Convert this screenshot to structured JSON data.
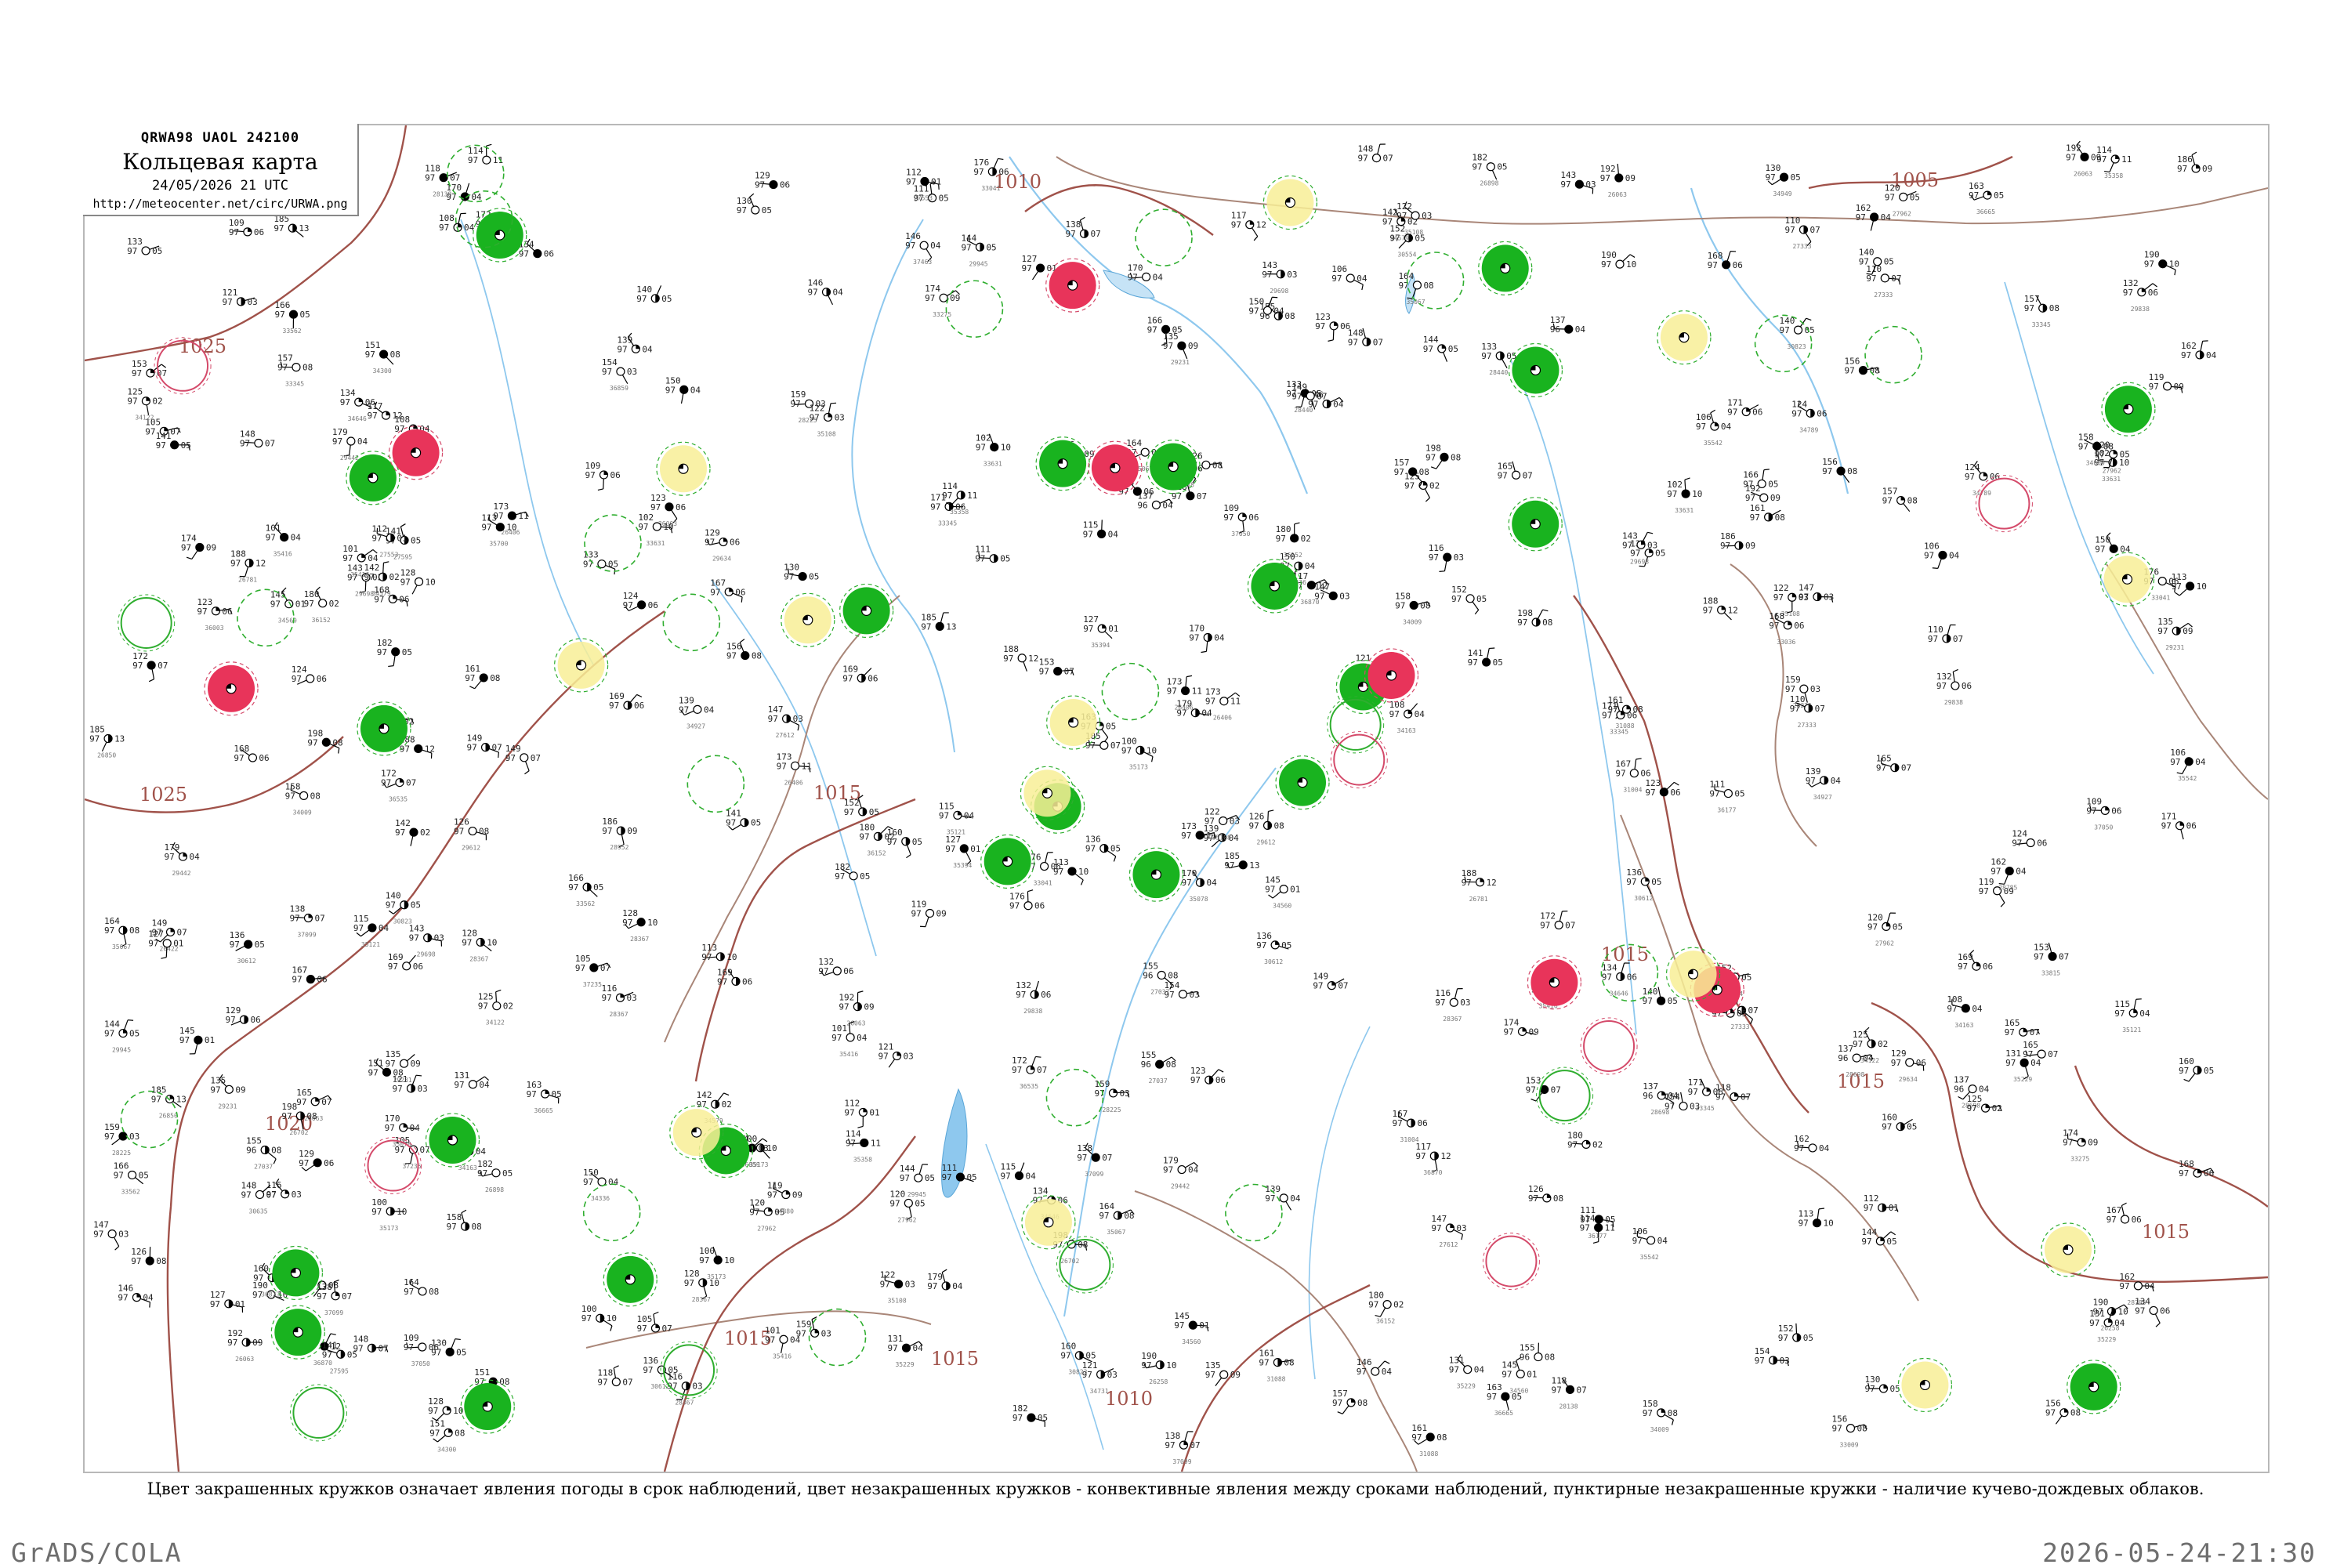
{
  "header": {
    "product_code": "QRWA98  UAOL  242100",
    "title": "Кольцевая карта",
    "valid_time": "24/05/2026 21 UTC",
    "source_url": "http://meteocenter.net/circ/URWA.png"
  },
  "legend_caption": "Цвет закрашенных кружков означает явления погоды в срок наблюдений, цвет незакрашенных кружков - конвективные явления между сроками наблюдений, пунктирные незакрашенные кружки - наличие кучево-дождевых облаков.",
  "footer": {
    "left": "GrADS/COLA",
    "right": "2026-05-24-21:30"
  },
  "isobar_labels": [
    "1025",
    "1020",
    "1015",
    "1010",
    "1005"
  ],
  "colors": {
    "isobar": "#a0524a",
    "river": "#8ec8ee",
    "border": "#a98678",
    "fill_green": "#19b31f",
    "fill_red": "#e8345a",
    "fill_yellow": "#f8ef96",
    "ring_green": "#2fae2f",
    "ring_red": "#d44a6a"
  },
  "stations": [
    {
      "p": "190",
      "t": "97",
      "d": "10",
      "id": "26258"
    },
    {
      "p": "149",
      "t": "97",
      "d": "07",
      "id": "26422"
    },
    {
      "p": "173",
      "t": "97",
      "d": "11",
      "id": "26406"
    },
    {
      "p": "165",
      "t": "97",
      "d": "07",
      "id": "26063"
    },
    {
      "p": "155",
      "t": "96",
      "d": "08",
      "id": "27037"
    },
    {
      "p": "147",
      "t": "97",
      "d": "03",
      "id": "27612"
    },
    {
      "p": "141",
      "t": "97",
      "d": "05",
      "id": "27595"
    },
    {
      "p": "137",
      "t": "96",
      "d": "04",
      "id": "28698"
    },
    {
      "p": "133",
      "t": "97",
      "d": "05",
      "id": "28440"
    },
    {
      "p": "129",
      "t": "97",
      "d": "06",
      "id": "29634"
    },
    {
      "p": "125",
      "t": "97",
      "d": "02",
      "id": "34122"
    },
    {
      "p": "121",
      "t": "97",
      "d": "03",
      "id": "34731"
    },
    {
      "p": "119",
      "t": "97",
      "d": "09",
      "id": "34880"
    },
    {
      "p": "115",
      "t": "97",
      "d": "04",
      "id": "35121"
    },
    {
      "p": "113",
      "t": "97",
      "d": "10",
      "id": "35700"
    },
    {
      "p": "111",
      "t": "97",
      "d": "05",
      "id": "36177"
    },
    {
      "p": "109",
      "t": "97",
      "d": "06",
      "id": "37050"
    },
    {
      "p": "105",
      "t": "97",
      "d": "07",
      "id": "37235"
    },
    {
      "p": "159",
      "t": "97",
      "d": "03",
      "id": "28225"
    },
    {
      "p": "157",
      "t": "97",
      "d": "08",
      "id": "33345"
    },
    {
      "p": "153",
      "t": "97",
      "d": "07",
      "id": "33815"
    },
    {
      "p": "151",
      "t": "97",
      "d": "08",
      "id": "34300"
    },
    {
      "p": "145",
      "t": "97",
      "d": "01",
      "id": "34560"
    },
    {
      "p": "139",
      "t": "97",
      "d": "04",
      "id": "34927"
    },
    {
      "p": "131",
      "t": "97",
      "d": "04",
      "id": "35229"
    },
    {
      "p": "127",
      "t": "97",
      "d": "01",
      "id": "35394"
    },
    {
      "p": "123",
      "t": "97",
      "d": "06",
      "id": "36003"
    },
    {
      "p": "117",
      "t": "97",
      "d": "12",
      "id": "36870"
    },
    {
      "p": "186",
      "t": "97",
      "d": "09",
      "id": "28952"
    },
    {
      "p": "170",
      "t": "97",
      "d": "04",
      "id": "35078"
    },
    {
      "p": "164",
      "t": "97",
      "d": "08",
      "id": "35067"
    },
    {
      "p": "162",
      "t": "97",
      "d": "04",
      "id": "28785"
    },
    {
      "p": "160",
      "t": "97",
      "d": "05",
      "id": "30823"
    },
    {
      "p": "152",
      "t": "97",
      "d": "05",
      "id": "30554"
    },
    {
      "p": "148",
      "t": "97",
      "d": "07",
      "id": "30635"
    },
    {
      "p": "143",
      "t": "97",
      "d": "03",
      "id": "29698"
    },
    {
      "p": "135",
      "t": "97",
      "d": "09",
      "id": "29231"
    },
    {
      "p": "128",
      "t": "97",
      "d": "10",
      "id": "28367"
    },
    {
      "p": "120",
      "t": "97",
      "d": "05",
      "id": "27962"
    },
    {
      "p": "112",
      "t": "97",
      "d": "01",
      "id": "27553"
    },
    {
      "p": "108",
      "t": "97",
      "d": "04",
      "id": "34163"
    },
    {
      "p": "102",
      "t": "97",
      "d": "10",
      "id": "33631"
    },
    {
      "p": "198",
      "t": "97",
      "d": "08",
      "id": "26702"
    },
    {
      "p": "185",
      "t": "97",
      "d": "13",
      "id": "26850"
    },
    {
      "p": "176",
      "t": "97",
      "d": "06",
      "id": "33041"
    },
    {
      "p": "168",
      "t": "97",
      "d": "06",
      "id": "33036"
    },
    {
      "p": "156",
      "t": "97",
      "d": "08",
      "id": "33009"
    },
    {
      "p": "144",
      "t": "97",
      "d": "05",
      "id": "29945"
    },
    {
      "p": "132",
      "t": "97",
      "d": "06",
      "id": "29838"
    },
    {
      "p": "126",
      "t": "97",
      "d": "08",
      "id": "29612"
    },
    {
      "p": "118",
      "t": "97",
      "d": "07",
      "id": "28138"
    },
    {
      "p": "110",
      "t": "97",
      "d": "07",
      "id": "27333"
    },
    {
      "p": "182",
      "t": "97",
      "d": "05",
      "id": "26898"
    },
    {
      "p": "174",
      "t": "97",
      "d": "09",
      "id": "33275"
    },
    {
      "p": "166",
      "t": "97",
      "d": "05",
      "id": "33562"
    },
    {
      "p": "158",
      "t": "97",
      "d": "08",
      "id": "34009"
    },
    {
      "p": "150",
      "t": "97",
      "d": "04",
      "id": "34336"
    },
    {
      "p": "142",
      "t": "97",
      "d": "02",
      "id": "34579"
    },
    {
      "p": "134",
      "t": "97",
      "d": "06",
      "id": "34646"
    },
    {
      "p": "122",
      "t": "97",
      "d": "03",
      "id": "35108"
    },
    {
      "p": "114",
      "t": "97",
      "d": "11",
      "id": "35358"
    },
    {
      "p": "106",
      "t": "97",
      "d": "04",
      "id": "35542"
    },
    {
      "p": "180",
      "t": "97",
      "d": "02",
      "id": "36152"
    },
    {
      "p": "172",
      "t": "97",
      "d": "07",
      "id": "36535"
    },
    {
      "p": "163",
      "t": "97",
      "d": "05",
      "id": "36665"
    },
    {
      "p": "154",
      "t": "97",
      "d": "03",
      "id": "36859"
    },
    {
      "p": "146",
      "t": "97",
      "d": "04",
      "id": "37463"
    },
    {
      "p": "138",
      "t": "97",
      "d": "07",
      "id": "37099"
    },
    {
      "p": "130",
      "t": "97",
      "d": "05",
      "id": "34949"
    },
    {
      "p": "124",
      "t": "97",
      "d": "06",
      "id": "34789"
    },
    {
      "p": "116",
      "t": "97",
      "d": "03",
      "id": "28367"
    },
    {
      "p": "192",
      "t": "97",
      "d": "09",
      "id": "26063"
    },
    {
      "p": "179",
      "t": "97",
      "d": "04",
      "id": "29442"
    },
    {
      "p": "167",
      "t": "97",
      "d": "06",
      "id": "31004"
    },
    {
      "p": "161",
      "t": "97",
      "d": "08",
      "id": "31088"
    },
    {
      "p": "140",
      "t": "97",
      "d": "05",
      "id": "30823"
    },
    {
      "p": "136",
      "t": "97",
      "d": "05",
      "id": "30612"
    },
    {
      "p": "100",
      "t": "97",
      "d": "10",
      "id": "35173"
    },
    {
      "p": "101",
      "t": "97",
      "d": "04",
      "id": "35416"
    },
    {
      "p": "188",
      "t": "97",
      "d": "12",
      "id": "26781"
    },
    {
      "p": "171",
      "t": "97",
      "d": "06",
      "id": "33345"
    },
    {
      "p": "169",
      "t": "97",
      "d": "06",
      "id": "33815"
    }
  ],
  "weather_circles": [
    {
      "kind": "fill",
      "color": "green"
    },
    {
      "kind": "fill",
      "color": "green"
    },
    {
      "kind": "fill",
      "color": "green"
    },
    {
      "kind": "fill",
      "color": "green"
    },
    {
      "kind": "fill",
      "color": "green"
    },
    {
      "kind": "fill",
      "color": "green"
    },
    {
      "kind": "fill",
      "color": "green"
    },
    {
      "kind": "fill",
      "color": "green"
    },
    {
      "kind": "fill",
      "color": "green"
    },
    {
      "kind": "fill",
      "color": "green"
    },
    {
      "kind": "fill",
      "color": "green"
    },
    {
      "kind": "fill",
      "color": "green"
    },
    {
      "kind": "fill",
      "color": "green"
    },
    {
      "kind": "fill",
      "color": "green"
    },
    {
      "kind": "fill",
      "color": "green"
    },
    {
      "kind": "fill",
      "color": "green"
    },
    {
      "kind": "fill",
      "color": "green"
    },
    {
      "kind": "fill",
      "color": "green"
    },
    {
      "kind": "fill",
      "color": "green"
    },
    {
      "kind": "fill",
      "color": "green"
    },
    {
      "kind": "fill",
      "color": "green"
    },
    {
      "kind": "fill",
      "color": "green"
    },
    {
      "kind": "fill",
      "color": "green"
    },
    {
      "kind": "fill",
      "color": "red"
    },
    {
      "kind": "fill",
      "color": "red"
    },
    {
      "kind": "fill",
      "color": "red"
    },
    {
      "kind": "fill",
      "color": "red"
    },
    {
      "kind": "fill",
      "color": "red"
    },
    {
      "kind": "fill",
      "color": "red"
    },
    {
      "kind": "fill",
      "color": "red"
    },
    {
      "kind": "fill",
      "color": "yellow"
    },
    {
      "kind": "fill",
      "color": "yellow"
    },
    {
      "kind": "fill",
      "color": "yellow"
    },
    {
      "kind": "fill",
      "color": "yellow"
    },
    {
      "kind": "fill",
      "color": "yellow"
    },
    {
      "kind": "fill",
      "color": "yellow"
    },
    {
      "kind": "fill",
      "color": "yellow"
    },
    {
      "kind": "fill",
      "color": "yellow"
    },
    {
      "kind": "fill",
      "color": "yellow"
    },
    {
      "kind": "fill",
      "color": "yellow"
    },
    {
      "kind": "fill",
      "color": "yellow"
    },
    {
      "kind": "fill",
      "color": "yellow"
    },
    {
      "kind": "fill",
      "color": "yellow"
    },
    {
      "kind": "ring",
      "color": "green"
    },
    {
      "kind": "ring",
      "color": "green"
    },
    {
      "kind": "ring",
      "color": "green"
    },
    {
      "kind": "ring",
      "color": "green"
    },
    {
      "kind": "ring",
      "color": "green"
    },
    {
      "kind": "ring",
      "color": "green"
    },
    {
      "kind": "ring",
      "color": "red"
    },
    {
      "kind": "ring",
      "color": "red"
    },
    {
      "kind": "ring",
      "color": "red"
    },
    {
      "kind": "ring",
      "color": "red"
    },
    {
      "kind": "ring",
      "color": "red"
    },
    {
      "kind": "ring",
      "color": "red"
    },
    {
      "kind": "dashed",
      "color": "green"
    },
    {
      "kind": "dashed",
      "color": "green"
    },
    {
      "kind": "dashed",
      "color": "green"
    },
    {
      "kind": "dashed",
      "color": "green"
    },
    {
      "kind": "dashed",
      "color": "green"
    },
    {
      "kind": "dashed",
      "color": "green"
    },
    {
      "kind": "dashed",
      "color": "green"
    },
    {
      "kind": "dashed",
      "color": "green"
    },
    {
      "kind": "dashed",
      "color": "green"
    },
    {
      "kind": "dashed",
      "color": "green"
    },
    {
      "kind": "dashed",
      "color": "green"
    },
    {
      "kind": "dashed",
      "color": "green"
    },
    {
      "kind": "dashed",
      "color": "green"
    },
    {
      "kind": "dashed",
      "color": "green"
    },
    {
      "kind": "dashed",
      "color": "green"
    },
    {
      "kind": "dashed",
      "color": "green"
    },
    {
      "kind": "dashed",
      "color": "green"
    },
    {
      "kind": "dashed",
      "color": "green"
    }
  ]
}
